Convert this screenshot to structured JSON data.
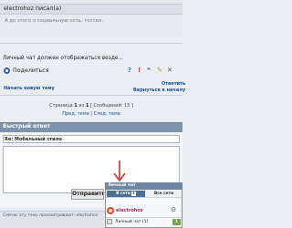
{
  "quote": {
    "author": "electrohoz писал(а)",
    "text": "А до этого я социальную сеть, тестил."
  },
  "post": {
    "text": "Личный чат должен отображаться везде..."
  },
  "share": {
    "label": "Поделиться"
  },
  "post_actions": [
    {
      "name": "info-button",
      "glyph": "?"
    },
    {
      "name": "report-button",
      "glyph": "!"
    },
    {
      "name": "quote-button",
      "glyph": "❝"
    },
    {
      "name": "edit-button",
      "glyph": "✎"
    },
    {
      "name": "delete-button",
      "glyph": "✕"
    }
  ],
  "links": {
    "new_topic": "Начать новую тему",
    "reply": "Ответить",
    "back": "Вернуться к началу"
  },
  "pagination": {
    "prefix": "Страница",
    "current": "1",
    "of": "из",
    "total": "1",
    "messages": "[ Сообщений: 15 ]"
  },
  "topic_nav": {
    "prev": "Пред. тема",
    "separator": "|",
    "next": "След. тема"
  },
  "quick_reply": {
    "title": "Быстрый ответ",
    "subject": "Re: Мобельный стило",
    "send_label": "Отправить"
  },
  "viewers": {
    "text": "Сейчас эту тему просматривают: electrohoz"
  },
  "private_chat": {
    "title": "Личный чат",
    "tab_online": "В сети",
    "tab_online_count": "1",
    "tab_all": "Все сети",
    "user": "electrohoz",
    "footer_label": "Личный чат (1)",
    "footer_count": "1"
  },
  "colors": {
    "quick_reply_header": "#7d93ab",
    "link": "#1a4f9a",
    "chat_user": "#c2185b",
    "arrow": "#d0302a"
  }
}
